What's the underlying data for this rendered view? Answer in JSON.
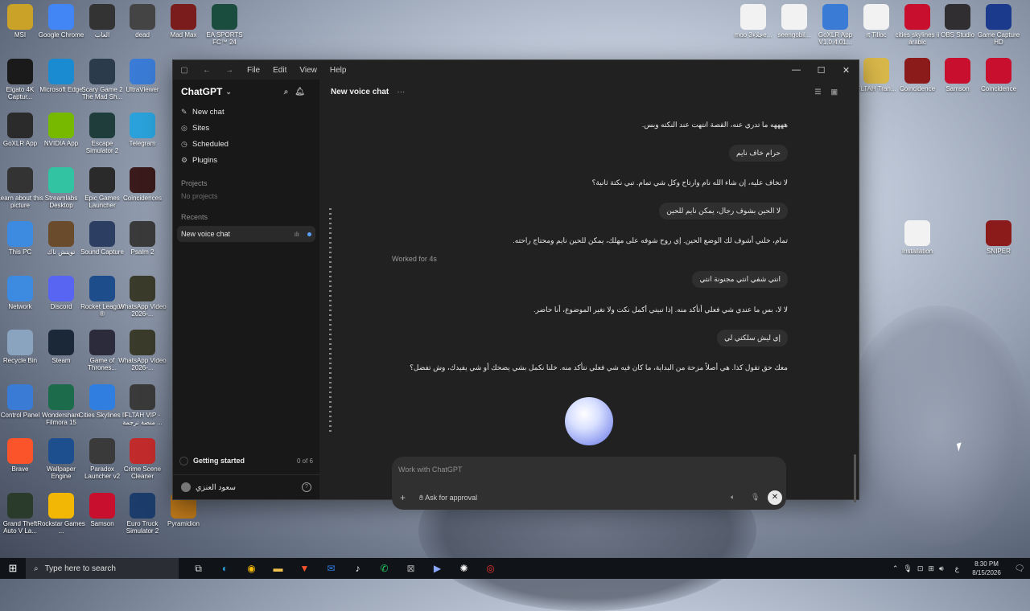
{
  "desktop": {
    "icons": [
      {
        "label": "MSI",
        "color": "#c9a227"
      },
      {
        "label": "Google Chrome",
        "color": "#4285f4"
      },
      {
        "label": "العاب",
        "color": "#333"
      },
      {
        "label": "dead",
        "color": "#444"
      },
      {
        "label": "Mad Max",
        "color": "#7a1c1c"
      },
      {
        "label": "EA SPORTS FC™ 24",
        "color": "#1b4d3e"
      },
      {
        "label": "Elgato 4K Captur...",
        "color": "#1a1a1a"
      },
      {
        "label": "Microsoft Edge",
        "color": "#1b8bd1"
      },
      {
        "label": "Scary Game 2 The Mad Sh...",
        "color": "#2b3b4b"
      },
      {
        "label": "UltraViewer",
        "color": "#3a7bd5"
      },
      {
        "label": "GoXLR App",
        "color": "#2b2b2b"
      },
      {
        "label": "NVIDIA App",
        "color": "#76b900"
      },
      {
        "label": "Escape Simulator 2",
        "color": "#1f3d3a"
      },
      {
        "label": "Telegram",
        "color": "#2aa1da"
      },
      {
        "label": "Learn about this picture",
        "color": "#333"
      },
      {
        "label": "Streamlabs Desktop",
        "color": "#31c3a2"
      },
      {
        "label": "Epic Games Launcher",
        "color": "#2a2a2a"
      },
      {
        "label": "Coincidences",
        "color": "#3a1a1a"
      },
      {
        "label": "This PC",
        "color": "#3d8be0"
      },
      {
        "label": "تويتش تاك",
        "color": "#6a4b2b"
      },
      {
        "label": "Sound Capture",
        "color": "#2d3e63"
      },
      {
        "label": "Psalm 2",
        "color": "#3a3a3a"
      },
      {
        "label": "Network",
        "color": "#3d8be0"
      },
      {
        "label": "Discord",
        "color": "#5865f2"
      },
      {
        "label": "Rocket League ®",
        "color": "#1e4d8b"
      },
      {
        "label": "WhatsApp Video 2026-...",
        "color": "#3b3b2b"
      },
      {
        "label": "Recycle Bin",
        "color": "#8aa4c0"
      },
      {
        "label": "Steam",
        "color": "#1b2838"
      },
      {
        "label": "Game of Thrones...",
        "color": "#2b2b3b"
      },
      {
        "label": "WhatsApp Video 2026-...",
        "color": "#3b3b2b"
      },
      {
        "label": "Control Panel",
        "color": "#3a7bd5"
      },
      {
        "label": "Wondershare Filmora 15",
        "color": "#1c6b4b"
      },
      {
        "label": "Cities Skylines II",
        "color": "#2f7ee0"
      },
      {
        "label": "FLTAH VIP - منصة ترجمة ...",
        "color": "#3a3a3a"
      },
      {
        "label": "Brave",
        "color": "#fb542b"
      },
      {
        "label": "Wallpaper Engine",
        "color": "#1d4f8f"
      },
      {
        "label": "Paradox Launcher v2",
        "color": "#3a3a3a"
      },
      {
        "label": "Crime Scene Cleaner",
        "color": "#c22b2b"
      },
      {
        "label": "Grand Theft Auto V La...",
        "color": "#2b3b2b"
      },
      {
        "label": "Rockstar Games ...",
        "color": "#f2b705"
      },
      {
        "label": "Samson",
        "color": "#c8102e"
      },
      {
        "label": "Euro Truck Simulator 2",
        "color": "#1c3d6b"
      },
      {
        "label": "Pyramidion",
        "color": "#c07a1a"
      }
    ],
    "right_icons": [
      {
        "label": "moo جلاء3e...",
        "color": "#f2f2f2"
      },
      {
        "label": "seengobil...",
        "color": "#f2f2f2"
      },
      {
        "label": "GoXLR App V1.0.4.01...",
        "color": "#3a7bd5"
      },
      {
        "label": "rt Tilloc",
        "color": "#f2f2f2"
      },
      {
        "label": "cities skylines ii arabic",
        "color": "#c8102e"
      },
      {
        "label": "OBS Studio",
        "color": "#302e31"
      },
      {
        "label": "Game Capture HD",
        "color": "#1b3a8b"
      },
      {
        "label": "FLTAH Tran...",
        "color": "#d9b84a"
      },
      {
        "label": "Coincidence",
        "color": "#8b1a1a"
      },
      {
        "label": "Samson",
        "color": "#c8102e"
      },
      {
        "label": "Coincidence",
        "color": "#c8102e"
      },
      {
        "label": "Installation",
        "color": "#f2f2f2"
      },
      {
        "label": "SNIPER",
        "color": "#8b1a1a"
      }
    ]
  },
  "window": {
    "menu": [
      "File",
      "Edit",
      "View",
      "Help"
    ],
    "sidebar": {
      "title": "ChatGPT",
      "nav": [
        {
          "icon": "✎",
          "label": "New chat"
        },
        {
          "icon": "◎",
          "label": "Sites"
        },
        {
          "icon": "◷",
          "label": "Scheduled"
        },
        {
          "icon": "⚙",
          "label": "Plugins"
        }
      ],
      "projects_heading": "Projects",
      "projects_empty": "No projects",
      "recents_heading": "Recents",
      "recent_item": "New voice chat",
      "getting_started": "Getting started",
      "getting_started_count": "0 of 6",
      "user_name": "سعود العنزي"
    },
    "main": {
      "title": "New voice chat",
      "messages": [
        {
          "role": "ai",
          "text": "ههههه ما تدري عنه، القصة انتهت عند النكته وبس."
        },
        {
          "role": "user",
          "text": "حرام خاف نايم"
        },
        {
          "role": "ai",
          "text": "لا تخاف عليه، إن شاء الله نام وارتاح وكل شي تمام. تبي نكتة ثانية؟"
        },
        {
          "role": "user",
          "text": "لا الحين بشوف رجال، يمكن نايم للحين"
        },
        {
          "role": "ai",
          "text": "تمام، خلني أشوف لك الوضع الحين. إي روح شوفه على مهلك، يمكن للحين نايم ومحتاج راحته."
        },
        {
          "role": "user",
          "text": "انتي شفي انتي مجنونة انتي"
        },
        {
          "role": "ai",
          "text": "لا لا، بس ما عندي شي فعلي أتأكد منه. إذا تبيني أكمل نكت ولا نغير الموضوع، أنا حاضر."
        },
        {
          "role": "user",
          "text": "إي ليش سلكتي لي"
        },
        {
          "role": "ai",
          "text": "معك حق تقول كذا. هي أصلاً مزحة من البداية، ما كان فيه شي فعلي نتأكد منه. خلنا نكمل بشي يضحك أو شي يفيدك، وش تفضل؟"
        }
      ],
      "worked_for": "Worked for 4s",
      "composer_placeholder": "Work with ChatGPT",
      "ask_for_approval": "Ask for approval"
    }
  },
  "taskbar": {
    "search_placeholder": "Type here to search",
    "time": "8:30 PM",
    "date": "8/15/2026",
    "lang": "ع"
  }
}
